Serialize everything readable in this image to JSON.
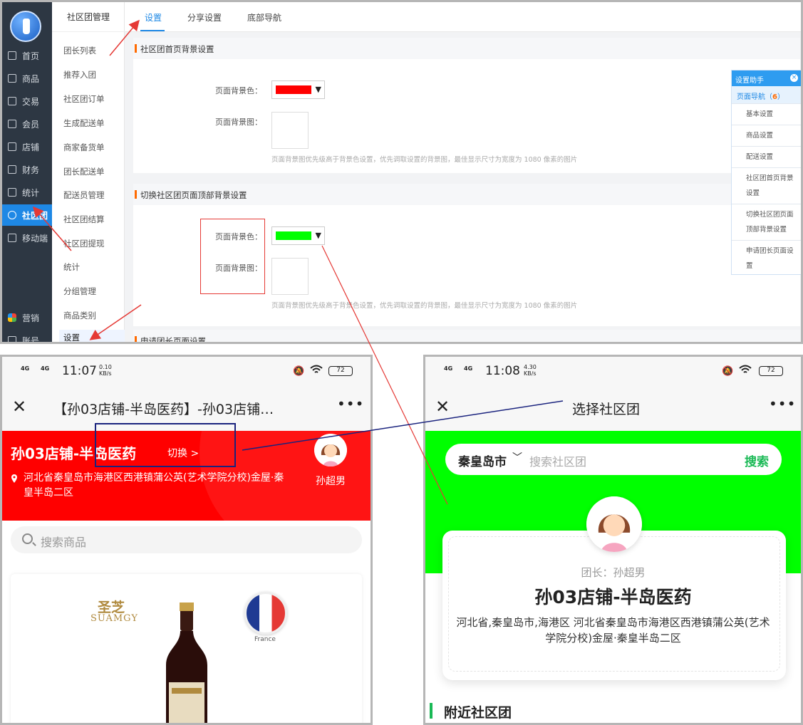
{
  "admin": {
    "rail": [
      {
        "label": "首页",
        "icon": "monitor-icon"
      },
      {
        "label": "商品",
        "icon": "tag-icon"
      },
      {
        "label": "交易",
        "icon": "order-icon"
      },
      {
        "label": "会员",
        "icon": "user-icon"
      },
      {
        "label": "店铺",
        "icon": "store-icon"
      },
      {
        "label": "财务",
        "icon": "yen-icon"
      },
      {
        "label": "统计",
        "icon": "bar-chart-icon"
      },
      {
        "label": "社区团",
        "icon": "community-icon"
      },
      {
        "label": "移动端",
        "icon": "chat-icon"
      },
      {
        "label": "营销",
        "icon": "apps-icon"
      },
      {
        "label": "账号",
        "icon": "gear-icon"
      }
    ],
    "sub_nav": {
      "title": "社区团管理",
      "items": [
        "团长列表",
        "推荐入团",
        "社区团订单",
        "生成配送单",
        "商家备货单",
        "团长配送单",
        "配送员管理",
        "社区团结算",
        "社区团提现",
        "统计",
        "分组管理",
        "商品类别",
        "设置"
      ]
    },
    "tabs": [
      "设置",
      "分享设置",
      "底部导航"
    ],
    "section1": {
      "title": "社区团首页背景设置",
      "bg_color_label": "页面背景色：",
      "bg_color": "#ff0000",
      "bg_image_label": "页面背景图：",
      "hint": "页面背景图优先级高于背景色设置，优先调取设置的背景图，最佳显示尺寸为宽度为 1080 像素的图片"
    },
    "section2": {
      "title": "切换社区团页面顶部背景设置",
      "bg_color_label": "页面背景色：",
      "bg_color": "#00ff00",
      "bg_image_label": "页面背景图：",
      "hint": "页面背景图优先级高于背景色设置，优先调取设置的背景图，最佳显示尺寸为宽度为 1080 像素的图片"
    },
    "section3": {
      "title": "申请团长页面设置"
    },
    "helper": {
      "title": "设置助手",
      "nav_label": "页面导航（",
      "nav_count": "6",
      "nav_close": "）",
      "items": [
        "基本设置",
        "商品设置",
        "配送设置",
        "社区团首页背景设置",
        "切换社区团页面顶部背景设置",
        "申请团长页面设置"
      ]
    }
  },
  "phone_left": {
    "status": {
      "signal1": "4G",
      "signal2": "4G",
      "time": "11:07",
      "speed": "0.10",
      "speed_unit": "KB/s",
      "battery": "72"
    },
    "nav_title": "【孙03店铺-半岛医药】-孙03店铺…",
    "store_name": "孙03店铺-半岛医药",
    "switch_label": "切换 >",
    "address": "河北省秦皇岛市海港区西港镇蒲公英(艺术学院分校)金屋·秦皇半岛二区",
    "leader": "孙超男",
    "banner_color": "#ff0000",
    "search_placeholder": "搜索商品",
    "brand_cn": "圣芝",
    "brand_en": "SUAMGY",
    "flag_label": "France"
  },
  "phone_right": {
    "status": {
      "signal1": "4G",
      "signal2": "4G",
      "time": "11:08",
      "speed": "4.30",
      "speed_unit": "KB/s",
      "battery": "72"
    },
    "nav_title": "选择社区团",
    "banner_color": "#00ff00",
    "city": "秦皇岛市",
    "search_placeholder": "搜索社区团",
    "search_button": "搜索",
    "leader_label": "团长：孙超男",
    "store_name": "孙03店铺-半岛医药",
    "full_address": "河北省,秦皇岛市,海港区 河北省秦皇岛市海港区西港镇蒲公英(艺术学院分校)金屋·秦皇半岛二区",
    "nearby_title": "附近社区团"
  }
}
